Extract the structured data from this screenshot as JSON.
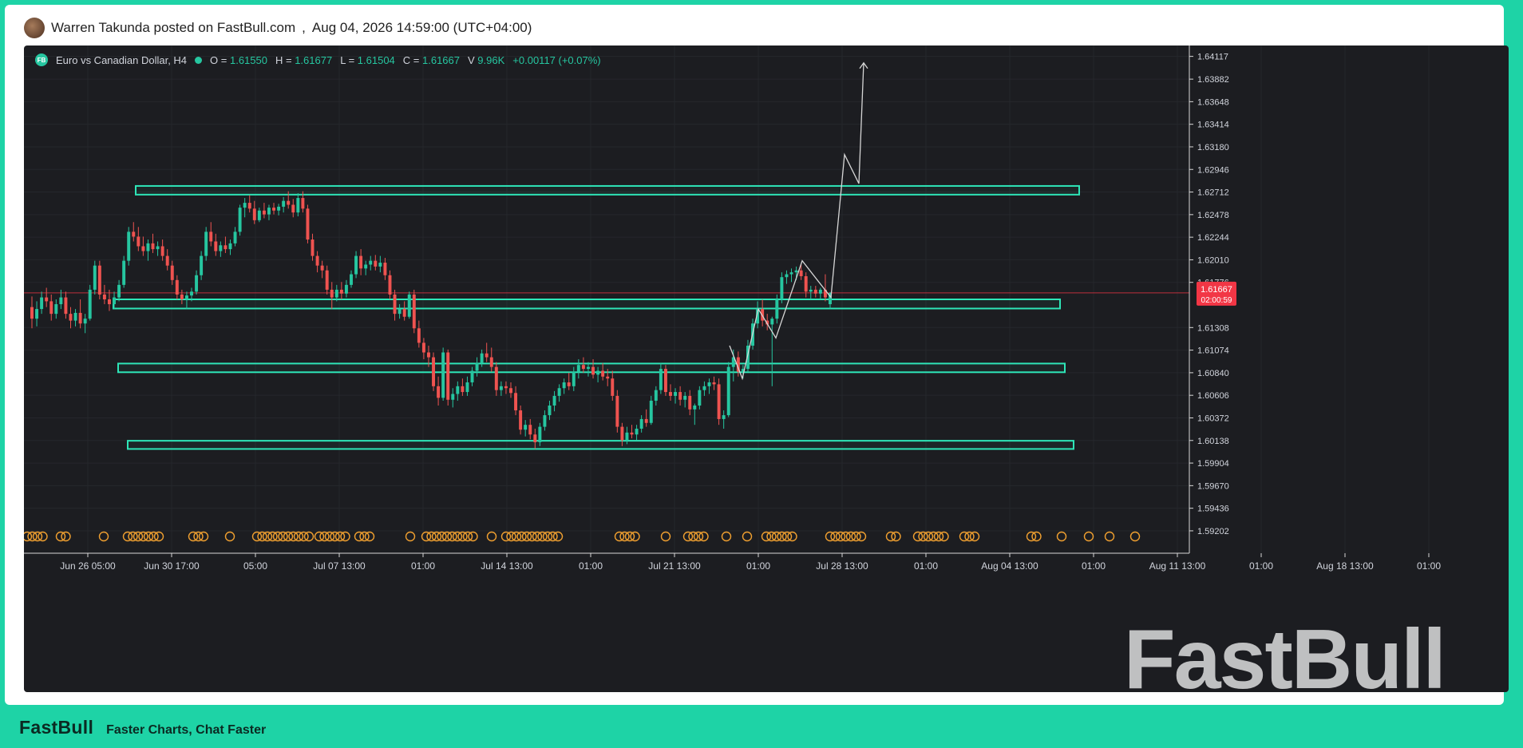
{
  "post": {
    "author_line": "Warren Takunda posted on FastBull.com",
    "separator": ",",
    "datetime": "Aug 04, 2026 14:59:00 (UTC+04:00)"
  },
  "footer": {
    "brand": "FastBull",
    "tagline": "Faster Charts, Chat Faster"
  },
  "watermark": "FastBull",
  "colors": {
    "up": "#26c6a0",
    "down": "#ef5350",
    "zone": "#2ee6b8",
    "price_tag": "#f23645",
    "event_marker": "#f0a030"
  },
  "legend": {
    "logo": "FB",
    "symbol": "Euro vs Canadian Dollar, H4",
    "o_label": "O =",
    "o_value": "1.61550",
    "h_label": "H =",
    "h_value": "1.61677",
    "l_label": "L =",
    "l_value": "1.61504",
    "c_label": "C =",
    "c_value": "1.61667",
    "v_label": "V",
    "v_value": "9.96K",
    "change": "+0.00117 (+0.07%)"
  },
  "chart_data": {
    "type": "candlestick",
    "symbol": "Euro vs Canadian Dollar, H4",
    "ylim": [
      1.5897,
      1.6423
    ],
    "y_ticks": [
      "1.64117",
      "1.63882",
      "1.63648",
      "1.63414",
      "1.63180",
      "1.62946",
      "1.62712",
      "1.62478",
      "1.62244",
      "1.62010",
      "1.61776",
      "1.61308",
      "1.61074",
      "1.60840",
      "1.60606",
      "1.60372",
      "1.60138",
      "1.59904",
      "1.59670",
      "1.59436",
      "1.59202"
    ],
    "x_ticks": [
      "Jun 26 05:00",
      "Jun 30 17:00",
      "05:00",
      "Jul 07 13:00",
      "01:00",
      "Jul 14 13:00",
      "01:00",
      "Jul 21 13:00",
      "01:00",
      "Jul 28 13:00",
      "01:00",
      "Aug 04 13:00",
      "01:00",
      "Aug 11 13:00",
      "01:00",
      "Aug 18 13:00",
      "01:00"
    ],
    "current_price": "1.61667",
    "countdown": "02:00:59",
    "candles": [
      [
        1.6152,
        1.6163,
        1.613,
        1.614
      ],
      [
        1.614,
        1.6158,
        1.6132,
        1.615
      ],
      [
        1.615,
        1.6168,
        1.6145,
        1.6162
      ],
      [
        1.6162,
        1.6172,
        1.6152,
        1.6158
      ],
      [
        1.6158,
        1.6165,
        1.6138,
        1.6145
      ],
      [
        1.6145,
        1.616,
        1.614,
        1.6155
      ],
      [
        1.6155,
        1.617,
        1.615,
        1.6162
      ],
      [
        1.6162,
        1.6168,
        1.614,
        1.6145
      ],
      [
        1.6145,
        1.6152,
        1.613,
        1.6138
      ],
      [
        1.6138,
        1.615,
        1.6132,
        1.6146
      ],
      [
        1.6146,
        1.616,
        1.613,
        1.6135
      ],
      [
        1.6135,
        1.6145,
        1.6125,
        1.614
      ],
      [
        1.614,
        1.6175,
        1.6138,
        1.617
      ],
      [
        1.617,
        1.62,
        1.6165,
        1.6195
      ],
      [
        1.6195,
        1.62,
        1.616,
        1.6165
      ],
      [
        1.6165,
        1.6175,
        1.6155,
        1.616
      ],
      [
        1.616,
        1.617,
        1.6148,
        1.6155
      ],
      [
        1.6155,
        1.6168,
        1.615,
        1.6162
      ],
      [
        1.6162,
        1.618,
        1.6158,
        1.6175
      ],
      [
        1.6175,
        1.6205,
        1.6172,
        1.62
      ],
      [
        1.62,
        1.6235,
        1.6195,
        1.623
      ],
      [
        1.623,
        1.624,
        1.622,
        1.6225
      ],
      [
        1.6225,
        1.6235,
        1.621,
        1.6215
      ],
      [
        1.6215,
        1.6225,
        1.6205,
        1.621
      ],
      [
        1.621,
        1.6222,
        1.62,
        1.6218
      ],
      [
        1.6218,
        1.6228,
        1.6208,
        1.6212
      ],
      [
        1.6212,
        1.622,
        1.6205,
        1.6215
      ],
      [
        1.6215,
        1.6222,
        1.62,
        1.6205
      ],
      [
        1.6205,
        1.6212,
        1.619,
        1.6195
      ],
      [
        1.6195,
        1.62,
        1.6175,
        1.618
      ],
      [
        1.618,
        1.6185,
        1.616,
        1.6165
      ],
      [
        1.6165,
        1.617,
        1.6155,
        1.616
      ],
      [
        1.616,
        1.6168,
        1.615,
        1.6164
      ],
      [
        1.6164,
        1.6172,
        1.6158,
        1.6168
      ],
      [
        1.6168,
        1.619,
        1.6165,
        1.6185
      ],
      [
        1.6185,
        1.621,
        1.618,
        1.6205
      ],
      [
        1.6205,
        1.6235,
        1.62,
        1.623
      ],
      [
        1.623,
        1.624,
        1.6215,
        1.622
      ],
      [
        1.622,
        1.6228,
        1.6205,
        1.621
      ],
      [
        1.621,
        1.622,
        1.6204,
        1.6216
      ],
      [
        1.6216,
        1.6225,
        1.6208,
        1.6212
      ],
      [
        1.6212,
        1.6222,
        1.6206,
        1.6218
      ],
      [
        1.6218,
        1.6235,
        1.6215,
        1.623
      ],
      [
        1.623,
        1.6258,
        1.6226,
        1.6255
      ],
      [
        1.6255,
        1.6265,
        1.6245,
        1.626
      ],
      [
        1.626,
        1.6268,
        1.625,
        1.6254
      ],
      [
        1.6254,
        1.6262,
        1.6238,
        1.6242
      ],
      [
        1.6242,
        1.6255,
        1.624,
        1.6252
      ],
      [
        1.6252,
        1.626,
        1.6244,
        1.6248
      ],
      [
        1.6248,
        1.6258,
        1.6242,
        1.6255
      ],
      [
        1.6255,
        1.626,
        1.6248,
        1.6252
      ],
      [
        1.6252,
        1.6259,
        1.6247,
        1.6256
      ],
      [
        1.6256,
        1.6266,
        1.625,
        1.6262
      ],
      [
        1.6262,
        1.6272,
        1.6254,
        1.6258
      ],
      [
        1.6258,
        1.6264,
        1.6245,
        1.625
      ],
      [
        1.625,
        1.627,
        1.6246,
        1.6265
      ],
      [
        1.6265,
        1.6272,
        1.625,
        1.6254
      ],
      [
        1.6254,
        1.6258,
        1.6218,
        1.6222
      ],
      [
        1.6222,
        1.6228,
        1.62,
        1.6205
      ],
      [
        1.6205,
        1.621,
        1.6188,
        1.6195
      ],
      [
        1.6195,
        1.62,
        1.6182,
        1.619
      ],
      [
        1.619,
        1.6195,
        1.6165,
        1.617
      ],
      [
        1.617,
        1.6178,
        1.615,
        1.6162
      ],
      [
        1.6162,
        1.6175,
        1.6158,
        1.617
      ],
      [
        1.617,
        1.6178,
        1.616,
        1.6166
      ],
      [
        1.6166,
        1.618,
        1.6162,
        1.6175
      ],
      [
        1.6175,
        1.619,
        1.6172,
        1.6186
      ],
      [
        1.6186,
        1.621,
        1.6182,
        1.6205
      ],
      [
        1.6205,
        1.6212,
        1.6185,
        1.6192
      ],
      [
        1.6192,
        1.62,
        1.6185,
        1.6196
      ],
      [
        1.6196,
        1.6205,
        1.619,
        1.62
      ],
      [
        1.62,
        1.6206,
        1.619,
        1.6194
      ],
      [
        1.6194,
        1.6205,
        1.6188,
        1.6198
      ],
      [
        1.6198,
        1.6203,
        1.618,
        1.6185
      ],
      [
        1.6185,
        1.619,
        1.616,
        1.6165
      ],
      [
        1.6165,
        1.617,
        1.6138,
        1.6145
      ],
      [
        1.6145,
        1.6155,
        1.614,
        1.615
      ],
      [
        1.615,
        1.6158,
        1.6138,
        1.6142
      ],
      [
        1.6142,
        1.6168,
        1.614,
        1.6165
      ],
      [
        1.6165,
        1.617,
        1.6125,
        1.613
      ],
      [
        1.613,
        1.6138,
        1.611,
        1.6115
      ],
      [
        1.6115,
        1.612,
        1.6098,
        1.6105
      ],
      [
        1.6105,
        1.6112,
        1.609,
        1.61
      ],
      [
        1.61,
        1.6105,
        1.6065,
        1.607
      ],
      [
        1.607,
        1.608,
        1.605,
        1.6058
      ],
      [
        1.6058,
        1.611,
        1.6055,
        1.6105
      ],
      [
        1.6105,
        1.6108,
        1.605,
        1.6056
      ],
      [
        1.6056,
        1.6068,
        1.6048,
        1.6062
      ],
      [
        1.6062,
        1.6075,
        1.6055,
        1.607
      ],
      [
        1.607,
        1.6078,
        1.606,
        1.6064
      ],
      [
        1.6064,
        1.608,
        1.606,
        1.6074
      ],
      [
        1.6074,
        1.609,
        1.607,
        1.6086
      ],
      [
        1.6086,
        1.61,
        1.608,
        1.6094
      ],
      [
        1.6094,
        1.6108,
        1.609,
        1.6104
      ],
      [
        1.6104,
        1.6115,
        1.6095,
        1.61
      ],
      [
        1.61,
        1.611,
        1.6085,
        1.609
      ],
      [
        1.609,
        1.6095,
        1.606,
        1.6066
      ],
      [
        1.6066,
        1.6075,
        1.606,
        1.607
      ],
      [
        1.607,
        1.6075,
        1.6062,
        1.6068
      ],
      [
        1.6068,
        1.6074,
        1.6058,
        1.6063
      ],
      [
        1.6063,
        1.607,
        1.604,
        1.6045
      ],
      [
        1.6045,
        1.605,
        1.602,
        1.6025
      ],
      [
        1.6025,
        1.6035,
        1.6018,
        1.603
      ],
      [
        1.603,
        1.6036,
        1.6015,
        1.602
      ],
      [
        1.602,
        1.6026,
        1.6005,
        1.6012
      ],
      [
        1.6012,
        1.6032,
        1.6008,
        1.6028
      ],
      [
        1.6028,
        1.6045,
        1.6024,
        1.604
      ],
      [
        1.604,
        1.6055,
        1.6035,
        1.605
      ],
      [
        1.605,
        1.6065,
        1.6044,
        1.606
      ],
      [
        1.606,
        1.6072,
        1.6054,
        1.6068
      ],
      [
        1.6068,
        1.6078,
        1.6062,
        1.6074
      ],
      [
        1.6074,
        1.6084,
        1.6066,
        1.607
      ],
      [
        1.607,
        1.609,
        1.6065,
        1.6085
      ],
      [
        1.6085,
        1.6098,
        1.6078,
        1.6092
      ],
      [
        1.6092,
        1.61,
        1.6084,
        1.6088
      ],
      [
        1.6088,
        1.6095,
        1.608,
        1.609
      ],
      [
        1.609,
        1.6098,
        1.6078,
        1.6082
      ],
      [
        1.6082,
        1.609,
        1.6074,
        1.6086
      ],
      [
        1.6086,
        1.6094,
        1.6076,
        1.608
      ],
      [
        1.608,
        1.6088,
        1.607,
        1.6078
      ],
      [
        1.6078,
        1.6086,
        1.6055,
        1.606
      ],
      [
        1.606,
        1.6066,
        1.6022,
        1.6028
      ],
      [
        1.6028,
        1.6032,
        1.6008,
        1.6014
      ],
      [
        1.6014,
        1.6028,
        1.601,
        1.6022
      ],
      [
        1.6022,
        1.603,
        1.6016,
        1.602
      ],
      [
        1.602,
        1.603,
        1.6014,
        1.6026
      ],
      [
        1.6026,
        1.604,
        1.6022,
        1.6036
      ],
      [
        1.6036,
        1.6046,
        1.6028,
        1.6032
      ],
      [
        1.6032,
        1.606,
        1.603,
        1.6055
      ],
      [
        1.6055,
        1.607,
        1.605,
        1.6066
      ],
      [
        1.6066,
        1.6094,
        1.6062,
        1.6088
      ],
      [
        1.6088,
        1.6092,
        1.606,
        1.6064
      ],
      [
        1.6064,
        1.6072,
        1.6055,
        1.606
      ],
      [
        1.606,
        1.6068,
        1.6052,
        1.6064
      ],
      [
        1.6064,
        1.607,
        1.605,
        1.6056
      ],
      [
        1.6056,
        1.6064,
        1.6048,
        1.606
      ],
      [
        1.606,
        1.6066,
        1.604,
        1.6046
      ],
      [
        1.6046,
        1.6052,
        1.603,
        1.605
      ],
      [
        1.605,
        1.607,
        1.6046,
        1.6066
      ],
      [
        1.6066,
        1.6075,
        1.606,
        1.607
      ],
      [
        1.607,
        1.6078,
        1.6062,
        1.6074
      ],
      [
        1.6074,
        1.608,
        1.6066,
        1.6072
      ],
      [
        1.6072,
        1.6078,
        1.603,
        1.6036
      ],
      [
        1.6036,
        1.6045,
        1.6026,
        1.604
      ],
      [
        1.604,
        1.6095,
        1.6038,
        1.609
      ],
      [
        1.609,
        1.6108,
        1.6075,
        1.61
      ],
      [
        1.61,
        1.6106,
        1.608,
        1.6085
      ],
      [
        1.6085,
        1.6092,
        1.6078,
        1.6088
      ],
      [
        1.6088,
        1.6118,
        1.6085,
        1.6112
      ],
      [
        1.6112,
        1.614,
        1.6108,
        1.6135
      ],
      [
        1.6135,
        1.6158,
        1.613,
        1.615
      ],
      [
        1.615,
        1.616,
        1.6132,
        1.6138
      ],
      [
        1.6138,
        1.6145,
        1.6128,
        1.6134
      ],
      [
        1.6134,
        1.6142,
        1.607,
        1.614
      ],
      [
        1.614,
        1.6165,
        1.6135,
        1.616
      ],
      [
        1.616,
        1.6188,
        1.6156,
        1.6183
      ],
      [
        1.6183,
        1.619,
        1.6176,
        1.6186
      ],
      [
        1.6186,
        1.6192,
        1.6178,
        1.6188
      ],
      [
        1.6188,
        1.6194,
        1.618,
        1.619
      ],
      [
        1.619,
        1.6196,
        1.618,
        1.6184
      ],
      [
        1.6184,
        1.6188,
        1.6162,
        1.6168
      ],
      [
        1.6168,
        1.6174,
        1.616,
        1.617
      ],
      [
        1.617,
        1.6174,
        1.6162,
        1.6166
      ],
      [
        1.6166,
        1.6172,
        1.616,
        1.617
      ],
      [
        1.617,
        1.6186,
        1.6158,
        1.6162
      ],
      [
        1.6155,
        1.61677,
        1.61504,
        1.61667
      ]
    ],
    "zones": [
      {
        "from": 1.62685,
        "to": 1.62775
      },
      {
        "from": 1.61505,
        "to": 1.616
      },
      {
        "from": 1.60845,
        "to": 1.60935
      },
      {
        "from": 1.6005,
        "to": 1.60135
      }
    ],
    "projection": [
      {
        "date": "Jul 29",
        "price": 1.6112
      },
      {
        "date": "Jul 30",
        "price": 1.6078
      },
      {
        "date": "Jul 30",
        "price": 1.615
      },
      {
        "date": "Aug 01",
        "price": 1.612
      },
      {
        "date": "Aug 02",
        "price": 1.62
      },
      {
        "date": "Aug 04",
        "price": 1.6162
      },
      {
        "date": "Aug 05",
        "price": 1.631
      },
      {
        "date": "Aug 05",
        "price": 1.628
      },
      {
        "date": "Aug 05",
        "price": 1.6405
      }
    ],
    "event_markers": 120
  }
}
